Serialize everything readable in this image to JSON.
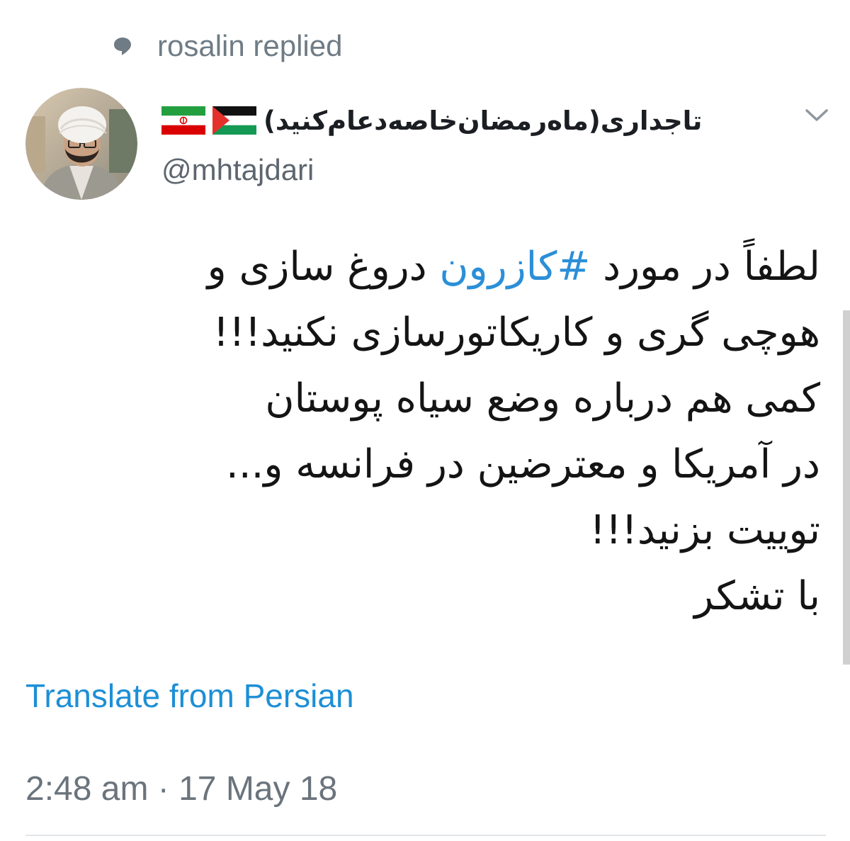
{
  "reply_context": {
    "icon": "speech-bubble-icon",
    "text": "rosalin replied"
  },
  "author": {
    "display_name": "تاجداری(ماه‌رمضان‌خاصه‌دعام‌کنید)",
    "flags": [
      "palestine-flag-icon",
      "iran-flag-icon"
    ],
    "handle": "@mhtajdari",
    "avatar": "avatar-photo"
  },
  "menu": {
    "icon": "chevron-down-icon"
  },
  "tweet": {
    "lines": [
      {
        "before": "لطفاً در مورد ",
        "hashtag": "#کازرون",
        "after": " دروغ سازی و"
      },
      {
        "text": "هوچی گری و کاریکاتورسازی نکنید!!!"
      },
      {
        "text": "کمی هم درباره وضع سیاه پوستان"
      },
      {
        "text": "در آمریکا و معترضین در فرانسه و..."
      },
      {
        "text": "توییت بزنید!!!"
      },
      {
        "text": "با تشکر"
      }
    ]
  },
  "translate_label": "Translate from Persian",
  "timestamp": "2:48 am · 17 May 18",
  "colors": {
    "link": "#1d8fd6",
    "hashtag": "#2b8fd8",
    "muted": "#6f7c86",
    "text": "#141414"
  }
}
